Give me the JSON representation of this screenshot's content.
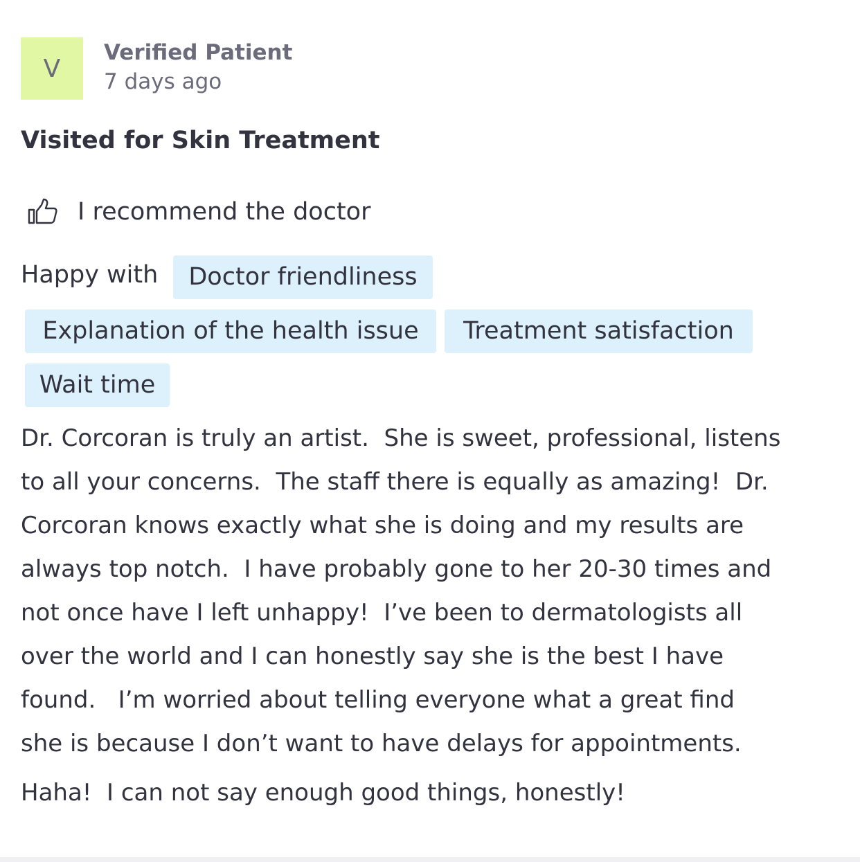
{
  "review": {
    "avatar_letter": "V",
    "author": "Verified Patient",
    "date": "7 days ago",
    "visit_reason": "Visited for Skin Treatment",
    "recommend_text": "I recommend the doctor",
    "happy_label": "Happy with",
    "tags": [
      "Doctor friendliness",
      "Explanation of the health issue",
      "Treatment satisfaction",
      "Wait time"
    ],
    "body_lines": [
      "Dr. Corcoran is truly an artist.  She is sweet, professional, listens",
      "to all your concerns.  The staff there is equally as amazing!  Dr.",
      "Corcoran knows exactly what she is doing and my results are",
      "always top notch.  I have probably gone to her 20-30 times and",
      "not once have I left unhappy!  I’ve been to dermatologists all",
      "over the world and I can honestly say she is the best I have",
      "found.   I’m worried about telling everyone what a great find",
      "she is because I don’t want to have delays for appointments.",
      "Haha!  I can not say enough good things, honestly!"
    ]
  },
  "colors": {
    "avatar_bg": "#e2f7a4",
    "tag_bg": "#dcf1fb",
    "text_primary": "#333340",
    "text_muted": "#6b6b7b"
  },
  "icons": {
    "recommend": "thumbs-up-icon"
  }
}
